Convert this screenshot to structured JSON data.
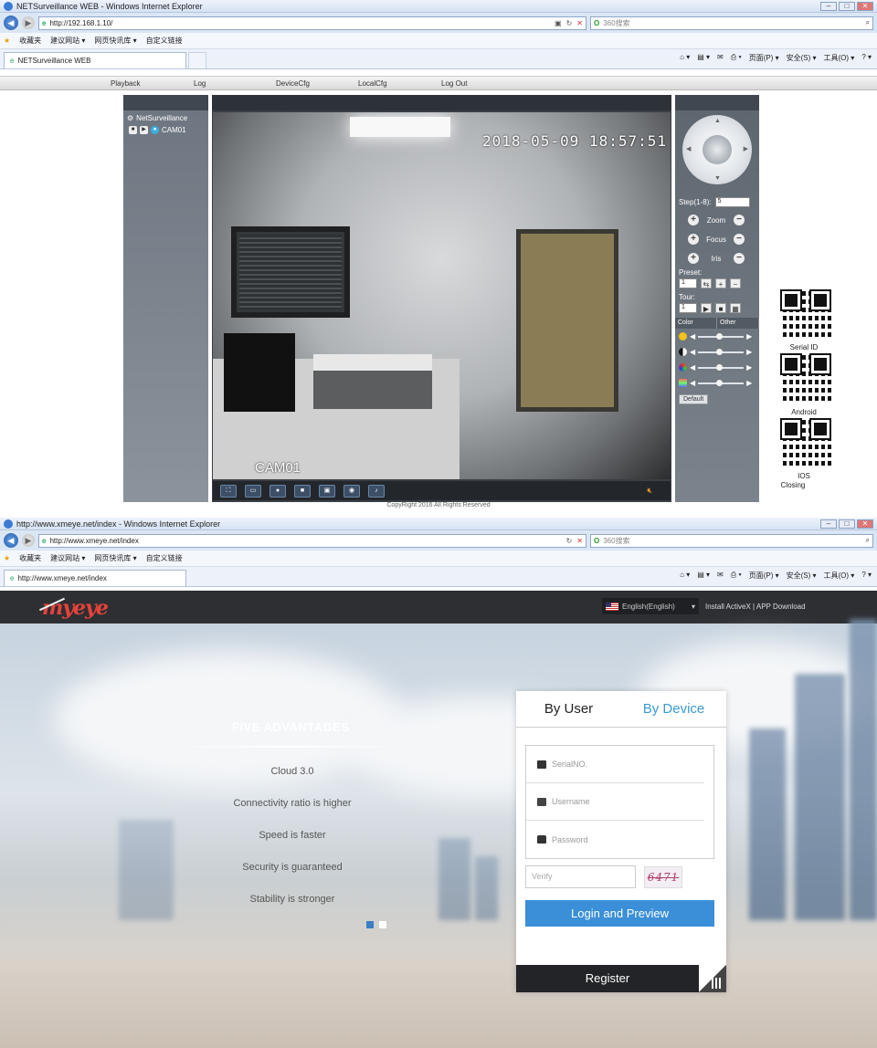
{
  "window1": {
    "title": "NETSurveillance WEB - Windows Internet Explorer",
    "url": "http://192.168.1.10/",
    "search_placeholder": "360搜索",
    "favorites": [
      "收藏夹",
      "建议网站 ▾",
      "网页快讯库 ▾",
      "自定义链接"
    ],
    "tab_title": "NETSurveillance WEB",
    "commands": [
      "页面(P) ▾",
      "安全(S) ▾",
      "工具(O) ▾",
      "? ▾"
    ],
    "menu": [
      "Playback",
      "Log",
      "DeviceCfg",
      "LocalCfg",
      "Log Out"
    ],
    "tree_root": "NetSurveillance",
    "tree_camera": "CAM01",
    "video_timestamp": "2018-05-09 18:57:51",
    "video_camera_label": "CAM01",
    "ptz": {
      "step_label": "Step(1-8):",
      "step_value": "5",
      "zoom": "Zoom",
      "focus": "Focus",
      "iris": "Iris",
      "preset_label": "Preset:",
      "preset_value": "1",
      "tour_label": "Tour:",
      "tour_value": "1"
    },
    "color_tabs": [
      "Color",
      "Other"
    ],
    "default_button": "Default",
    "copyright": "CopyRight 2016 All Rights Reserved",
    "qr_labels": {
      "serial": "Serial ID",
      "android": "Android",
      "ios": "IOS",
      "closing": "Closing"
    }
  },
  "window2": {
    "title": "http://www.xmeye.net/index - Windows Internet Explorer",
    "url": "http://www.xmeye.net/index",
    "search_placeholder": "360搜索",
    "favorites": [
      "收藏夹",
      "建议网站 ▾",
      "网页快讯库 ▾",
      "自定义链接"
    ],
    "tab_title": "http://www.xmeye.net/index",
    "commands": [
      "页面(P) ▾",
      "安全(S) ▾",
      "工具(O) ▾",
      "? ▾"
    ],
    "logo": "myeye",
    "language": "English(English)",
    "header_links": "Install ActiveX  |  APP Download",
    "advantages_title": "FIVE ADVANTAGES",
    "advantages": [
      "Cloud 3.0",
      "Connectivity ratio is higher",
      "Speed is faster",
      "Security is guaranteed",
      "Stability is stronger"
    ],
    "login": {
      "tab_user": "By User",
      "tab_device": "By Device",
      "serial_placeholder": "SerialNO.",
      "username_placeholder": "Username",
      "password_placeholder": "Password",
      "verify_placeholder": "Verify",
      "captcha": "6471",
      "login_button": "Login and Preview",
      "register_button": "Register"
    }
  }
}
